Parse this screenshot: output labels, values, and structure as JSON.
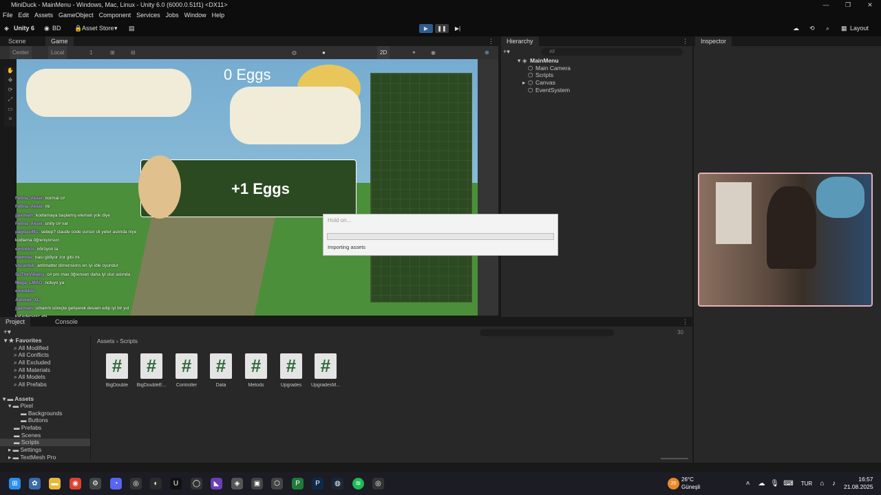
{
  "window": {
    "title": "MiniDuck - MainMenu - Windows, Mac, Linux - Unity 6.0 (6000.0.51f1) <DX11>"
  },
  "menu": [
    "File",
    "Edit",
    "Assets",
    "GameObject",
    "Component",
    "Services",
    "Jobs",
    "Window",
    "Help"
  ],
  "toolbar": {
    "unity_label": "Unity 6",
    "account": "BD",
    "asset_store": "Asset Store",
    "layout": "Layout"
  },
  "scene": {
    "tabs": [
      "Scene",
      "Game"
    ],
    "pivot": "Center",
    "space": "Local",
    "snap_value": "1",
    "mode_2d": "2D",
    "eggs_counter": "0 Eggs",
    "popup_text": "+1 Eggs"
  },
  "chat": [
    {
      "user": "Felina_Aksel:",
      "msg": "normal c#"
    },
    {
      "user": "Felina_Aksel:",
      "msg": "mi"
    },
    {
      "user": "jjaxmain:",
      "msg": "kodlamaya başlamış eleman yok diye"
    },
    {
      "user": "Felina_Aksel:",
      "msg": "unity c# var"
    },
    {
      "user": "pagdas461:",
      "msg": "sebep? claude code cursor cli yeter aslında niye"
    },
    {
      "user": "",
      "msg": "kodlama öğreniyorsun"
    },
    {
      "user": "eminkkis:",
      "msg": "nörüyon la"
    },
    {
      "user": "memree:",
      "msg": "nası gidiyor zor gibi mi"
    },
    {
      "user": "vxcardek:",
      "msg": "antimatter dimensions en iyi idle oyundur"
    },
    {
      "user": "SuTheVillains:",
      "msg": "c# pro max öğrensen daha iyi olur aslında"
    },
    {
      "user": "Mega_LMAO:",
      "msg": "noluyo ya"
    },
    {
      "user": "eminkkis:",
      "msg": ""
    },
    {
      "user": "Ashmet_XL:",
      "msg": ""
    },
    {
      "user": "jjaxmain:",
      "msg": "umarım süreçte gelişerek devam edip iyi bir yol"
    },
    {
      "user": "",
      "msg": "kat'edersiniz abi"
    }
  ],
  "hierarchy": {
    "tab": "Hierarchy",
    "search_placeholder": "All",
    "root": "MainMenu",
    "items": [
      "Main Camera",
      "Scripts",
      "Canvas",
      "EventSystem"
    ]
  },
  "inspector": {
    "tab": "Inspector"
  },
  "dialog": {
    "title": "Hold on...",
    "message": "Importing assets",
    "progress": 0
  },
  "project": {
    "tabs": [
      "Project",
      "Console"
    ],
    "breadcrumb": [
      "Assets",
      "Scripts"
    ],
    "count": "30",
    "favorites_label": "Favorites",
    "favorites": [
      "All Modified",
      "All Conflicts",
      "All Excluded",
      "All Materials",
      "All Models",
      "All Prefabs"
    ],
    "assets_label": "Assets",
    "tree": [
      "Pixel",
      "Backgrounds",
      "Buttons",
      "Prefabs",
      "Scenes",
      "Scripts",
      "Settings",
      "TextMesh Pro"
    ],
    "files": [
      "BigDouble",
      "BigDoubleE...",
      "Controller",
      "Data",
      "Metods",
      "Upgrades",
      "UpgradesM..."
    ]
  },
  "taskbar": {
    "weather_temp": "26°C",
    "weather_desc": "Güneşli",
    "language": "TUR",
    "time": "16:57",
    "date": "21.08.2025",
    "notification_badge": "20"
  },
  "colors": {
    "accent": "#2f5c8f",
    "game_panel": "#2c4a22",
    "sky": "#7fb2d4",
    "grass": "#4c8f3a"
  }
}
